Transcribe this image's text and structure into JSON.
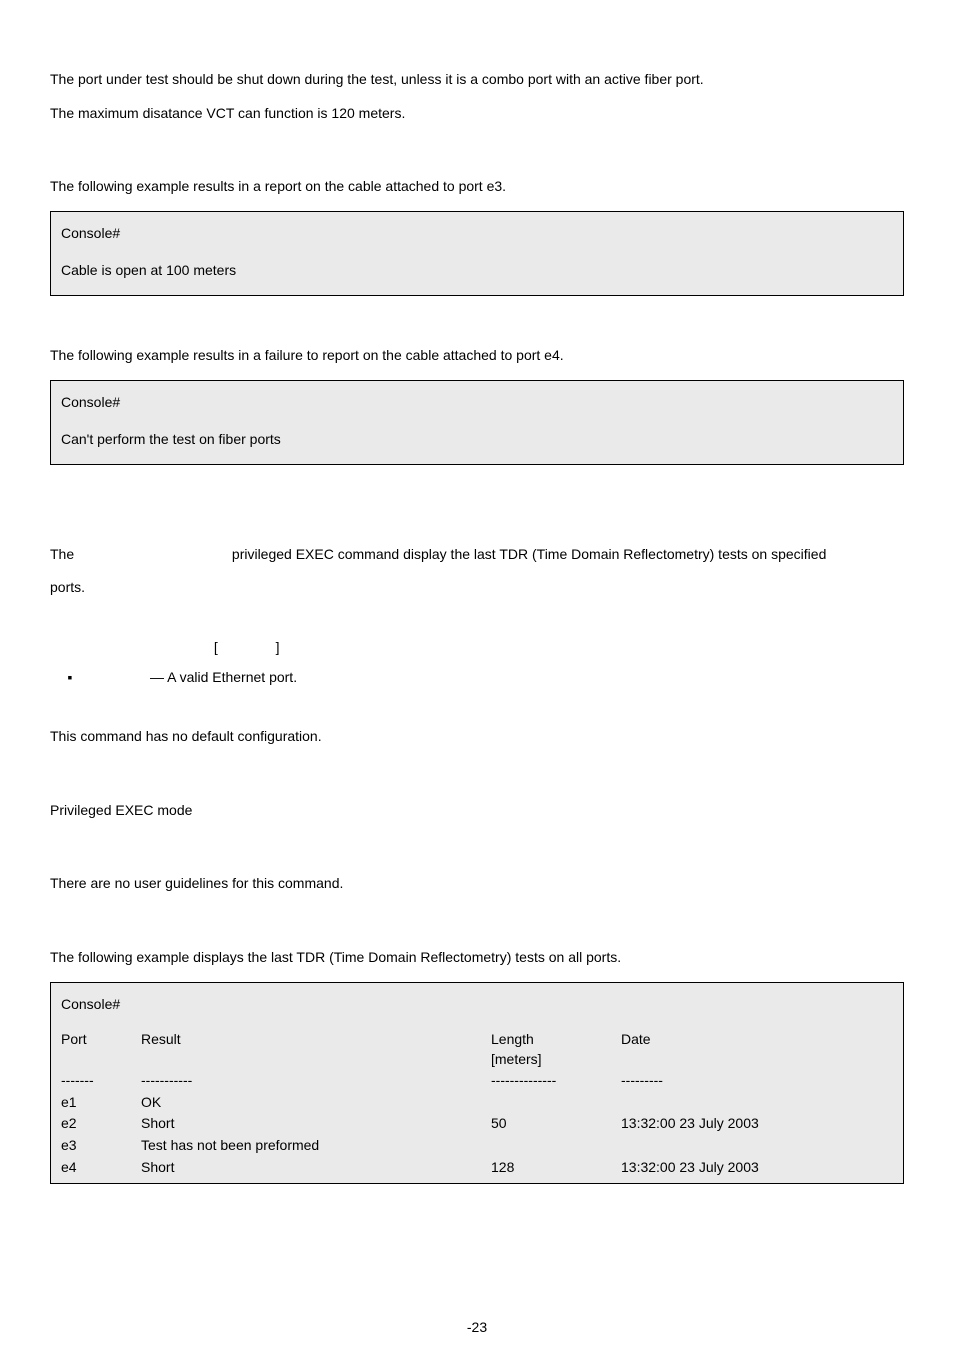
{
  "intro": {
    "p1": "The port under test should be shut down during the test, unless it is a combo port with an active fiber port.",
    "p2": "The maximum disatance VCT can function is 120 meters."
  },
  "example1": {
    "lead": "The following example results in a report on the cable attached to port e3.",
    "console_prompt": "Console#",
    "console_output": "Cable is open at 100 meters"
  },
  "example2": {
    "lead": "The following example results in a failure to report on the cable attached to port e4.",
    "console_prompt": "Console#",
    "console_output": "Can't perform the test on fiber ports"
  },
  "command": {
    "desc_prefix": "The",
    "desc_suffix": "privileged EXEC command display the last TDR (Time Domain Reflectometry) tests on specified",
    "desc_line2": "ports.",
    "syntax_open": "[",
    "syntax_close": "]",
    "bullet_marker": "▪",
    "param_text": "— A valid Ethernet port.",
    "default_cfg": "This command has no default configuration.",
    "mode": "Privileged EXEC mode",
    "guidelines": "There are no user guidelines for this command."
  },
  "example3": {
    "lead": "The following example displays the last TDR (Time Domain Reflectometry) tests on all ports.",
    "console_prompt": "Console#",
    "headers": {
      "port": "Port",
      "result": "Result",
      "length_l1": "Length",
      "length_l2": "[meters]",
      "date": "Date"
    },
    "divs": {
      "port": "-------",
      "result": "-----------",
      "length": "--------------",
      "date": "---------"
    },
    "rows": [
      {
        "port": "e1",
        "result": "OK",
        "length": "",
        "date": ""
      },
      {
        "port": "e2",
        "result": "Short",
        "length": "50",
        "date": "13:32:00 23 July 2003"
      },
      {
        "port": "e3",
        "result": "Test has not been preformed",
        "length": "",
        "date": ""
      },
      {
        "port": "e4",
        "result": "Short",
        "length": "128",
        "date": "13:32:00 23 July 2003"
      }
    ]
  },
  "page_number": "-23"
}
